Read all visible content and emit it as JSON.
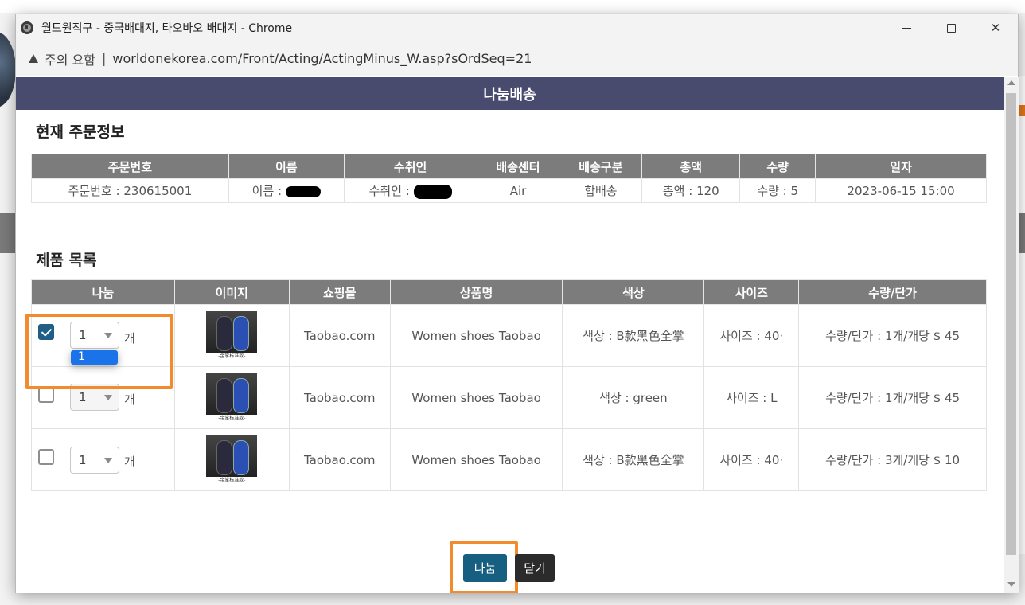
{
  "window": {
    "title": "월드원직구 - 중국배대지, 타오바오 배대지 - Chrome",
    "security_label": "주의 요함",
    "separator": "|",
    "url": "worldonekorea.com/Front/Acting/ActingMinus_W.asp?sOrdSeq=21"
  },
  "page": {
    "header": "나눔배송",
    "order_section_title": "현재 주문정보",
    "product_section_title": "제품 목록"
  },
  "order_table": {
    "headers": [
      "주문번호",
      "이름",
      "수취인",
      "배송센터",
      "배송구분",
      "총액",
      "수량",
      "일자"
    ],
    "row": {
      "order_no": "주문번호 : 230615001",
      "name": "이름 :",
      "recipient": "수취인 :",
      "center": "Air",
      "delivery_type": "합배송",
      "total": "총액 : 120",
      "qty": "수량 : 5",
      "date": "2023-06-15 15:00"
    }
  },
  "product_table": {
    "headers": [
      "나눔",
      "이미지",
      "쇼핑몰",
      "상품명",
      "색상",
      "사이즈",
      "수량/단가"
    ],
    "unit_label": "개",
    "dropdown_option": "1",
    "rows": [
      {
        "checked": true,
        "qty": "1",
        "mall": "Taobao.com",
        "name": "Women shoes Taobao",
        "color": "색상 : B款黑色全掌",
        "size": "사이즈 : 40·",
        "price": "수량/단가 : 1개/개당 $ 45",
        "thumb_caption": "-金掌标准款-"
      },
      {
        "checked": false,
        "qty": "1",
        "mall": "Taobao.com",
        "name": "Women shoes Taobao",
        "color": "색상 : green",
        "size": "사이즈 : L",
        "price": "수량/단가 : 1개/개당 $ 45",
        "thumb_caption": "-金掌标准款-"
      },
      {
        "checked": false,
        "qty": "1",
        "mall": "Taobao.com",
        "name": "Women shoes Taobao",
        "color": "색상 : B款黑色全掌",
        "size": "사이즈 : 40·",
        "price": "수량/단가 : 3개/개당 $ 10",
        "thumb_caption": "-金掌标准款-"
      }
    ]
  },
  "buttons": {
    "split": "나눔",
    "close": "닫기"
  },
  "colors": {
    "header_band": "#484a6e",
    "table_header": "#7c7c7c",
    "primary_button": "#175f80",
    "highlight": "#f28a2e"
  }
}
